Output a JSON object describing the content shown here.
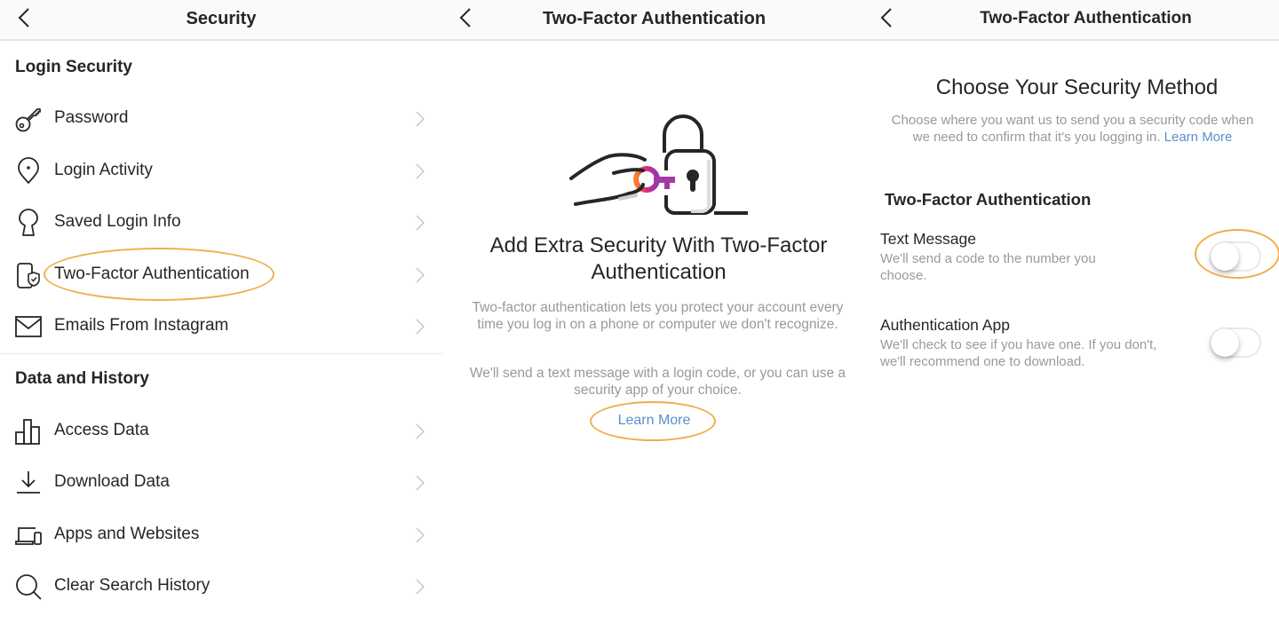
{
  "panels": {
    "security": {
      "header": {
        "title": "Security",
        "back_icon": "chevron-left-icon"
      },
      "sections": [
        {
          "title": "Login Security",
          "items": [
            {
              "label": "Password",
              "icon": "key-icon"
            },
            {
              "label": "Login Activity",
              "icon": "location-pin-icon"
            },
            {
              "label": "Saved Login Info",
              "icon": "keyhole-icon"
            },
            {
              "label": "Two-Factor Authentication",
              "icon": "phone-shield-icon",
              "highlighted": true
            },
            {
              "label": "Emails From Instagram",
              "icon": "envelope-icon"
            }
          ]
        },
        {
          "title": "Data and History",
          "items": [
            {
              "label": "Access Data",
              "icon": "bar-chart-icon"
            },
            {
              "label": "Download Data",
              "icon": "download-icon"
            },
            {
              "label": "Apps and Websites",
              "icon": "devices-icon"
            },
            {
              "label": "Clear Search History",
              "icon": "search-icon"
            }
          ]
        }
      ]
    },
    "two_factor_intro": {
      "header": {
        "title": "Two-Factor Authentication",
        "back_icon": "chevron-left-icon"
      },
      "illustration": "hand-key-padlock-illustration",
      "title": "Add Extra Security With Two-Factor Authentication",
      "paragraph1": "Two-factor authentication lets you protect your account every time you log in on a phone or computer we don't recognize.",
      "paragraph2": "We'll send a text message with a login code, or you can use a security app of your choice.",
      "learn_more": "Learn More"
    },
    "choose_method": {
      "header": {
        "title": "Two-Factor Authentication",
        "back_icon": "chevron-left-icon"
      },
      "title": "Choose Your Security Method",
      "description": "Choose where you want us to send you a security code when we need to confirm that it's you logging in.",
      "learn_more": "Learn More",
      "section_title": "Two-Factor Authentication",
      "options": [
        {
          "title": "Text Message",
          "description": "We'll send a code to the number you choose.",
          "enabled": false,
          "highlighted": true
        },
        {
          "title": "Authentication App",
          "description": "We'll check to see if you have one. If you don't, we'll recommend one to download.",
          "enabled": false
        }
      ]
    }
  },
  "colors": {
    "highlight": "#f0ae4b",
    "link": "#5a8fcb",
    "key_gradient_start": "#f58529",
    "key_gradient_end": "#8a3ab9"
  }
}
